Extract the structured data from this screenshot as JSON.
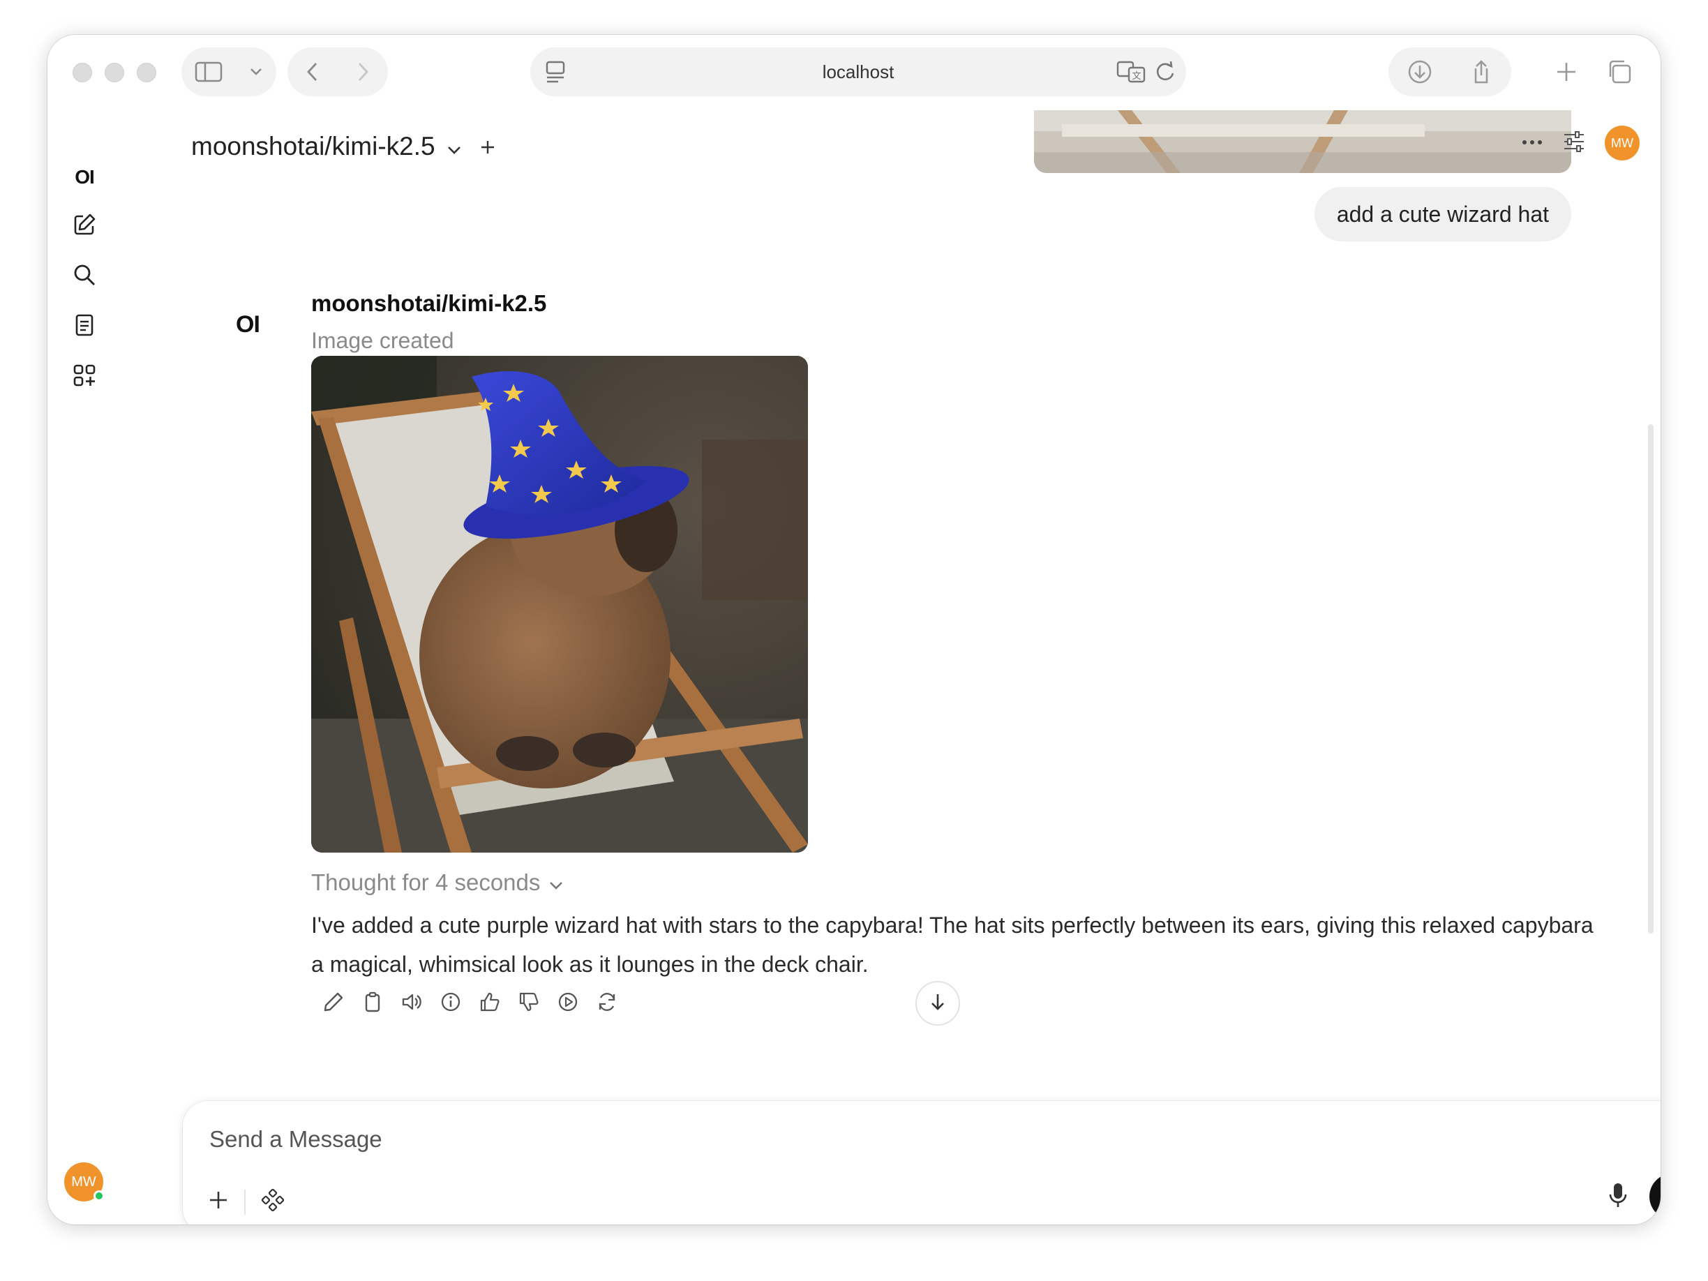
{
  "browser": {
    "url": "localhost"
  },
  "header": {
    "model_name": "moonshotai/kimi-k2.5",
    "avatar_initials": "MW"
  },
  "sidebar": {
    "logo": "OI",
    "avatar_initials": "MW"
  },
  "chat": {
    "user_message": "add a cute wizard hat",
    "assistant": {
      "logo": "OI",
      "name": "moonshotai/kimi-k2.5",
      "status": "Image created",
      "thought": "Thought for 4 seconds",
      "answer": "I've added a cute purple wizard hat with stars to the capybara! The hat sits perfectly between its ears, giving this relaxed capybara a magical, whimsical look as it lounges in the deck chair."
    }
  },
  "composer": {
    "placeholder": "Send a Message"
  },
  "colors": {
    "accent_avatar": "#f0932b",
    "online_dot": "#22c55e",
    "voice_button": "#111111"
  }
}
